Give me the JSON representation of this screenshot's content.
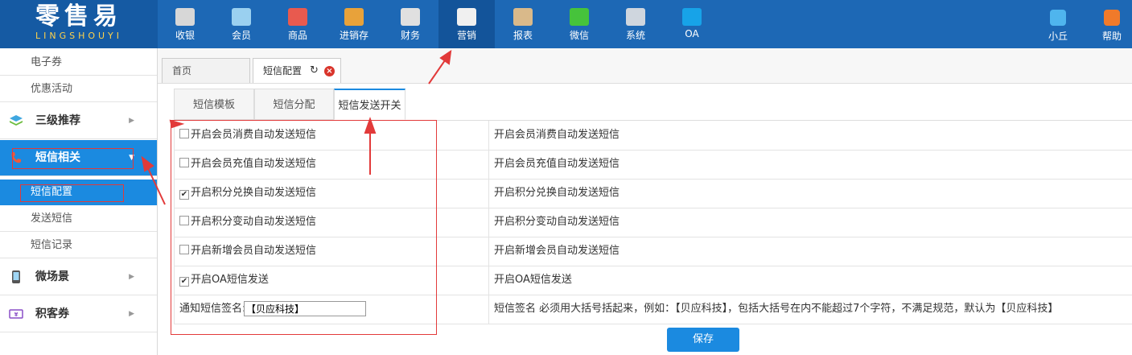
{
  "logo": {
    "cn": "零售易",
    "en": "LINGSHOUYI"
  },
  "nav": [
    {
      "label": "收银",
      "icon": "cash-register-icon",
      "color": "#d7d7d7"
    },
    {
      "label": "会员",
      "icon": "member-icon",
      "color": "#9ad0f0"
    },
    {
      "label": "商品",
      "icon": "goods-icon",
      "color": "#e85a4f"
    },
    {
      "label": "进销存",
      "icon": "inventory-icon",
      "color": "#e8a23a"
    },
    {
      "label": "财务",
      "icon": "finance-icon",
      "color": "#e0e0e0"
    },
    {
      "label": "营销",
      "icon": "megaphone-icon",
      "color": "#f0f0f0"
    },
    {
      "label": "报表",
      "icon": "report-icon",
      "color": "#d9b98a"
    },
    {
      "label": "微信",
      "icon": "wechat-icon",
      "color": "#46c33b"
    },
    {
      "label": "系统",
      "icon": "monitor-icon",
      "color": "#cfd6de"
    },
    {
      "label": "OA",
      "icon": "oa-icon",
      "color": "#17a3e8"
    }
  ],
  "user": {
    "name": "小丘",
    "help": "帮助"
  },
  "sidebar": {
    "top_items": [
      "电子券",
      "优惠活动"
    ],
    "group_recommend": "三级推荐",
    "group_sms": "短信相关",
    "sms_items": [
      "短信配置",
      "发送短信",
      "短信记录"
    ],
    "group_micro": "微场景",
    "group_coupon": "积客券"
  },
  "page_tabs": {
    "home": "首页",
    "current": "短信配置"
  },
  "sub_tabs": [
    "短信模板",
    "短信分配",
    "短信发送开关"
  ],
  "settings": [
    {
      "label": "开启会员消费自动发送短信",
      "checked": false,
      "desc": "开启会员消费自动发送短信"
    },
    {
      "label": "开启会员充值自动发送短信",
      "checked": false,
      "desc": "开启会员充值自动发送短信"
    },
    {
      "label": "开启积分兑换自动发送短信",
      "checked": true,
      "desc": "开启积分兑换自动发送短信"
    },
    {
      "label": "开启积分变动自动发送短信",
      "checked": false,
      "desc": "开启积分变动自动发送短信"
    },
    {
      "label": "开启新增会员自动发送短信",
      "checked": false,
      "desc": "开启新增会员自动发送短信"
    },
    {
      "label": "开启OA短信发送",
      "checked": true,
      "desc": "开启OA短信发送"
    }
  ],
  "signature": {
    "label": "通知短信签名:",
    "value": "【贝应科技】",
    "desc": "短信签名 必须用大括号括起来，例如：【贝应科技】，包括大括号在内不能超过7个字符，不满足规范，默认为【贝应科技】"
  },
  "save_label": "保存",
  "colors": {
    "topbar": "#1d68b5",
    "accent": "#1b8ae0",
    "annotation": "#e23a3a"
  }
}
